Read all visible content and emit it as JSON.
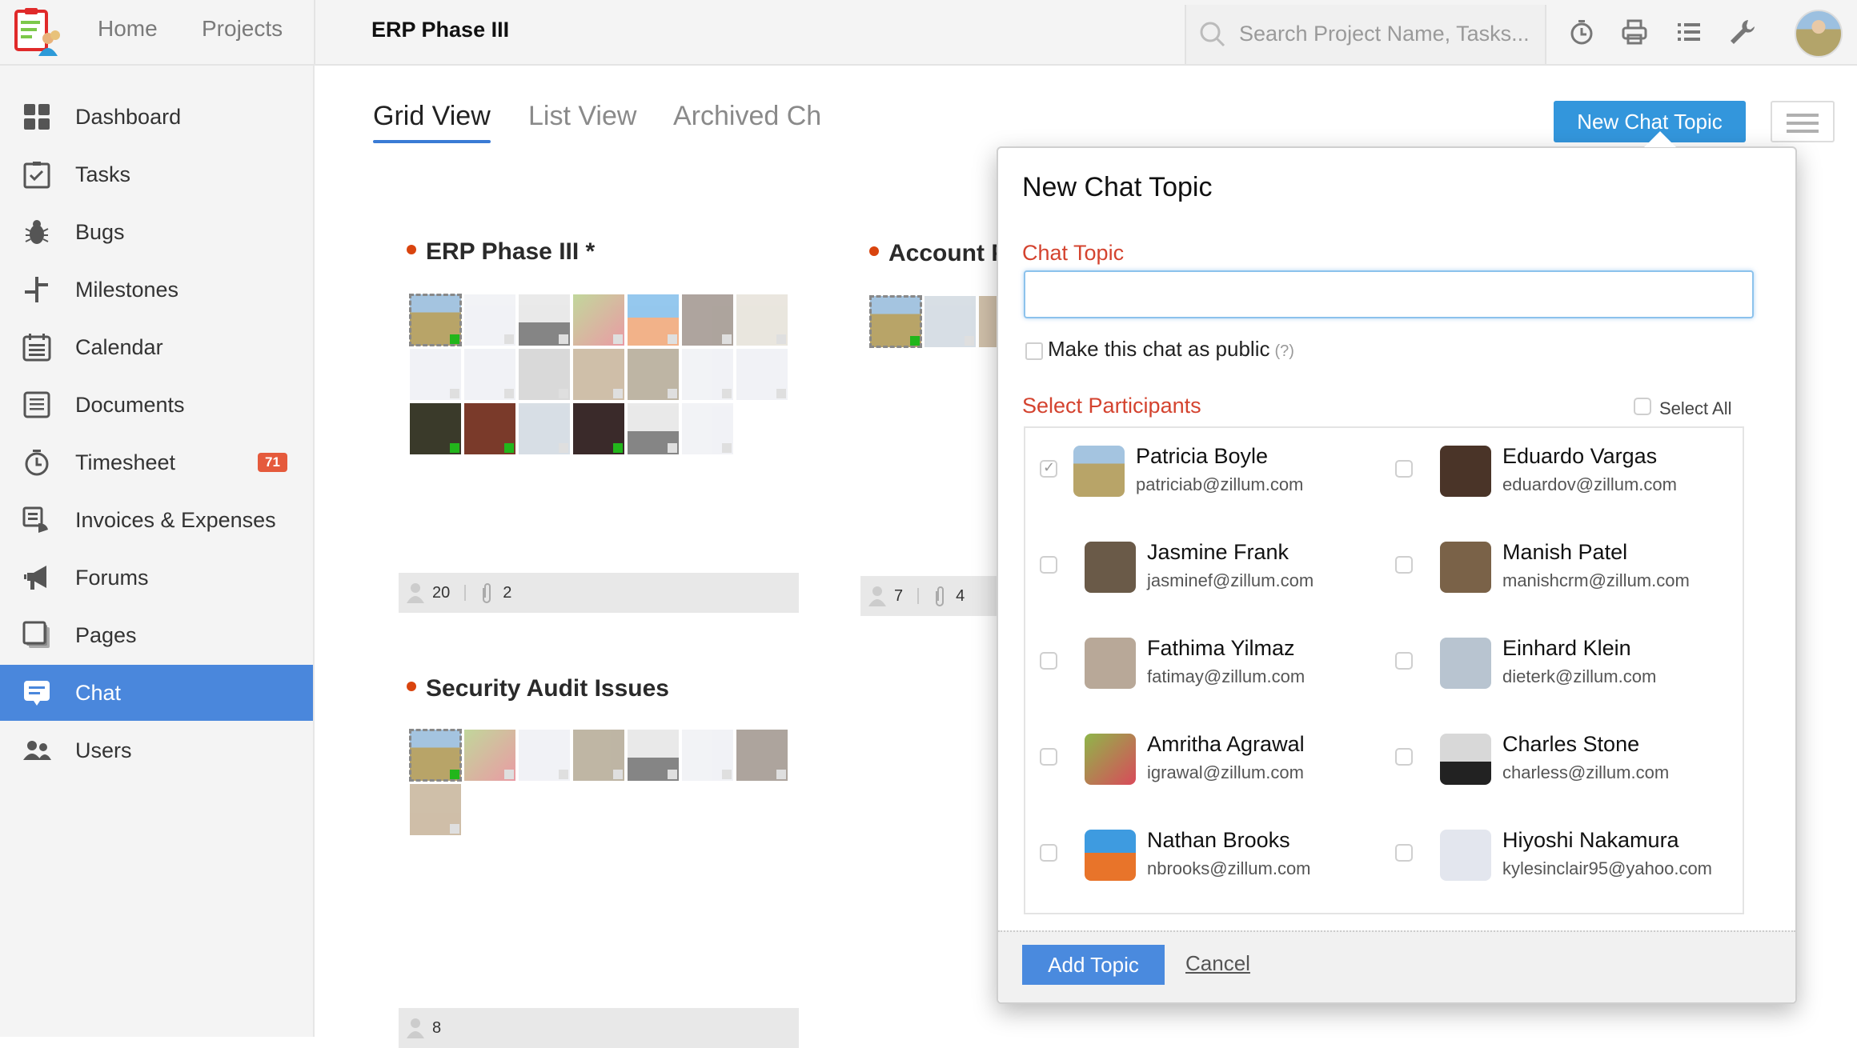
{
  "topbar": {
    "nav": [
      "Home",
      "Projects"
    ],
    "project_title": "ERP Phase III",
    "search_placeholder": "Search Project Name, Tasks...",
    "icons": [
      "timer-icon",
      "print-icon",
      "list-icon",
      "wrench-icon"
    ]
  },
  "sidebar": {
    "items": [
      {
        "label": "Dashboard",
        "icon": "dashboard-icon"
      },
      {
        "label": "Tasks",
        "icon": "tasks-icon"
      },
      {
        "label": "Bugs",
        "icon": "bug-icon"
      },
      {
        "label": "Milestones",
        "icon": "milestone-icon"
      },
      {
        "label": "Calendar",
        "icon": "calendar-icon"
      },
      {
        "label": "Documents",
        "icon": "document-icon"
      },
      {
        "label": "Timesheet",
        "icon": "timer-icon",
        "badge": "71"
      },
      {
        "label": "Invoices & Expenses",
        "icon": "invoice-icon"
      },
      {
        "label": "Forums",
        "icon": "megaphone-icon"
      },
      {
        "label": "Pages",
        "icon": "pages-icon"
      },
      {
        "label": "Chat",
        "icon": "chat-icon",
        "active": true
      },
      {
        "label": "Users",
        "icon": "users-icon"
      }
    ]
  },
  "tabs": [
    "Grid View",
    "List View",
    "Archived Ch"
  ],
  "new_topic_button": "New Chat Topic",
  "cards": [
    {
      "title": "ERP Phase III *",
      "members": "20",
      "attachments": "2"
    },
    {
      "title": "Account P",
      "members": "7",
      "attachments": "4"
    },
    {
      "title": "Security Audit Issues",
      "members": "8"
    }
  ],
  "dialog": {
    "title": "New Chat Topic",
    "topic_label": "Chat Topic",
    "topic_value": "",
    "public_label": "Make this chat as public",
    "help": "(?)",
    "participants_label": "Select Participants",
    "select_all": "Select All",
    "participants": [
      {
        "name": "Patricia Boyle",
        "email": "patriciab@zillum.com",
        "checked": true
      },
      {
        "name": "Eduardo Vargas",
        "email": "eduardov@zillum.com",
        "checked": false
      },
      {
        "name": "Jasmine Frank",
        "email": "jasminef@zillum.com",
        "checked": false
      },
      {
        "name": "Manish Patel",
        "email": "manishcrm@zillum.com",
        "checked": false
      },
      {
        "name": "Fathima Yilmaz",
        "email": "fatimay@zillum.com",
        "checked": false
      },
      {
        "name": "Einhard Klein",
        "email": "dieterk@zillum.com",
        "checked": false
      },
      {
        "name": "Amritha Agrawal",
        "email": "igrawal@zillum.com",
        "checked": false
      },
      {
        "name": "Charles Stone",
        "email": "charless@zillum.com",
        "checked": false
      },
      {
        "name": "Nathan Brooks",
        "email": "nbrooks@zillum.com",
        "checked": false
      },
      {
        "name": "Hiyoshi Nakamura",
        "email": "kylesinclair95@yahoo.com",
        "checked": false
      }
    ],
    "add_button": "Add Topic",
    "cancel": "Cancel"
  },
  "colors": {
    "accent": "#4a87dc",
    "label_red": "#d4432f",
    "online": "#22b61b",
    "badge": "#e55a3c"
  }
}
